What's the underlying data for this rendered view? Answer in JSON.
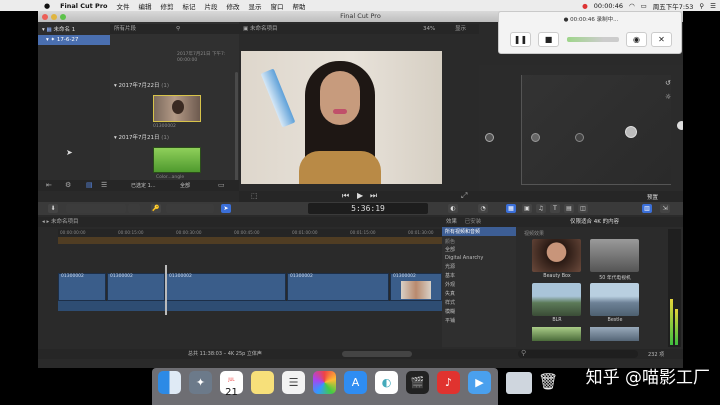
{
  "menubar": {
    "apple": "",
    "items": [
      "Final Cut Pro",
      "文件",
      "编辑",
      "修剪",
      "标记",
      "片段",
      "修改",
      "显示",
      "窗口",
      "帮助"
    ],
    "time": "00:00:46",
    "clock": "周五下午7:53"
  },
  "window": {
    "title": "Final Cut Pro"
  },
  "library": {
    "header": "所有片段",
    "library_name": "未命名 1",
    "event_name": "17-6-27",
    "event_meta_date": "2017年7月21日 下午7:",
    "event_meta_dur": "00:00:00",
    "groups": [
      {
        "date": "2017年7月22日",
        "count": "(1)",
        "clip_name": "01300002"
      },
      {
        "date": "2017年7月21日",
        "count": "(1)",
        "clip_name": "Color...angle"
      }
    ],
    "footer_selected": "已选定 1...",
    "footer_label": "全部"
  },
  "viewer": {
    "header": "未命名项目",
    "zoom": "34%",
    "display": "显示",
    "timecode": "5:36:19"
  },
  "inspector": {
    "preset": "预置"
  },
  "timeline": {
    "header": "未命名项目",
    "ruler": [
      "00:00:00:00",
      "00:00:15:00",
      "00:00:30:00",
      "00:00:45:00",
      "00:01:00:00",
      "00:01:15:00",
      "00:01:30:00"
    ],
    "clips": [
      "01300002",
      "01300002",
      "01300002",
      "01300002",
      "01300002"
    ],
    "status": "总共 11:38:03 – 4K 25p 立体声"
  },
  "effects": {
    "header": "效果",
    "tab2": "已安装",
    "group_header": "所有视频和音频",
    "browser_title": "仅限适合 4K 的内容",
    "subheader": "视频效果",
    "categories": [
      "颜色",
      "全部",
      "Digital Anarchy",
      "光源",
      "基本",
      "外观",
      "失真",
      "样式",
      "模糊",
      "平铺",
      "光源"
    ],
    "items": [
      {
        "label": "Beauty Box",
        "color": "#8a5a4a"
      },
      {
        "label": "50 年代电视机",
        "color": "#7a7a7a"
      },
      {
        "label": "BLR",
        "color": "#4f6a52"
      },
      {
        "label": "Bestle",
        "color": "#5d6f84"
      }
    ],
    "count": "232 项"
  },
  "recorder": {
    "title": "00:00:46 录制中...",
    "pause": "❚❚",
    "stop": "■",
    "close": "✕"
  },
  "dock": {
    "calendar_day": "21",
    "calendar_month": "JUL"
  },
  "watermark": "知乎 @喵影工厂"
}
